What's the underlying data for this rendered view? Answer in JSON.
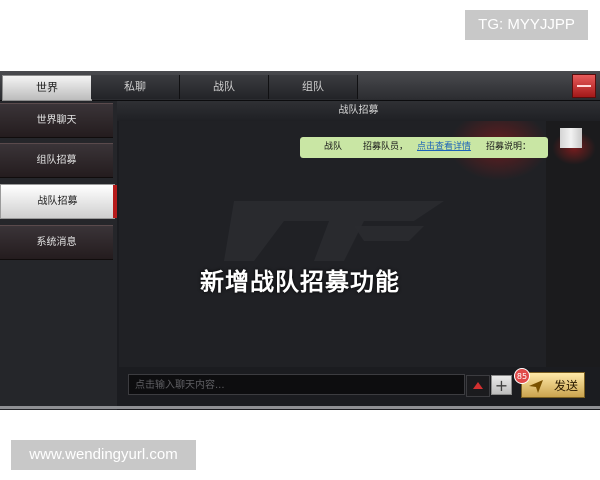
{
  "watermarks": {
    "tg": "TG: MYYJJPP",
    "site": "www.wendingyurl.com"
  },
  "tabs": [
    {
      "label": "世界",
      "active": true
    },
    {
      "label": "私聊",
      "active": false
    },
    {
      "label": "战队",
      "active": false
    },
    {
      "label": "组队",
      "active": false
    }
  ],
  "sidebar": {
    "items": [
      {
        "label": "世界聊天",
        "active": false
      },
      {
        "label": "组队招募",
        "active": false
      },
      {
        "label": "战队招募",
        "active": true
      },
      {
        "label": "系统消息",
        "active": false
      }
    ]
  },
  "panel": {
    "title": "战队招募"
  },
  "recruit_message": {
    "team": "战队",
    "recruit": "招募队员，",
    "link": "点击查看详情",
    "note": "招募说明："
  },
  "overlay_caption": "新增战队招募功能",
  "composer": {
    "placeholder": "点击输入聊天内容...",
    "send_label": "发送",
    "badge_count": "85",
    "plus": "+"
  },
  "colors": {
    "accent_red": "#b51b1b",
    "message_bg": "#c9e6a4",
    "link": "#1c63b8"
  },
  "icons": [
    "close-icon",
    "emoji-icon",
    "plus-icon",
    "send-plane-icon",
    "game-logo"
  ]
}
